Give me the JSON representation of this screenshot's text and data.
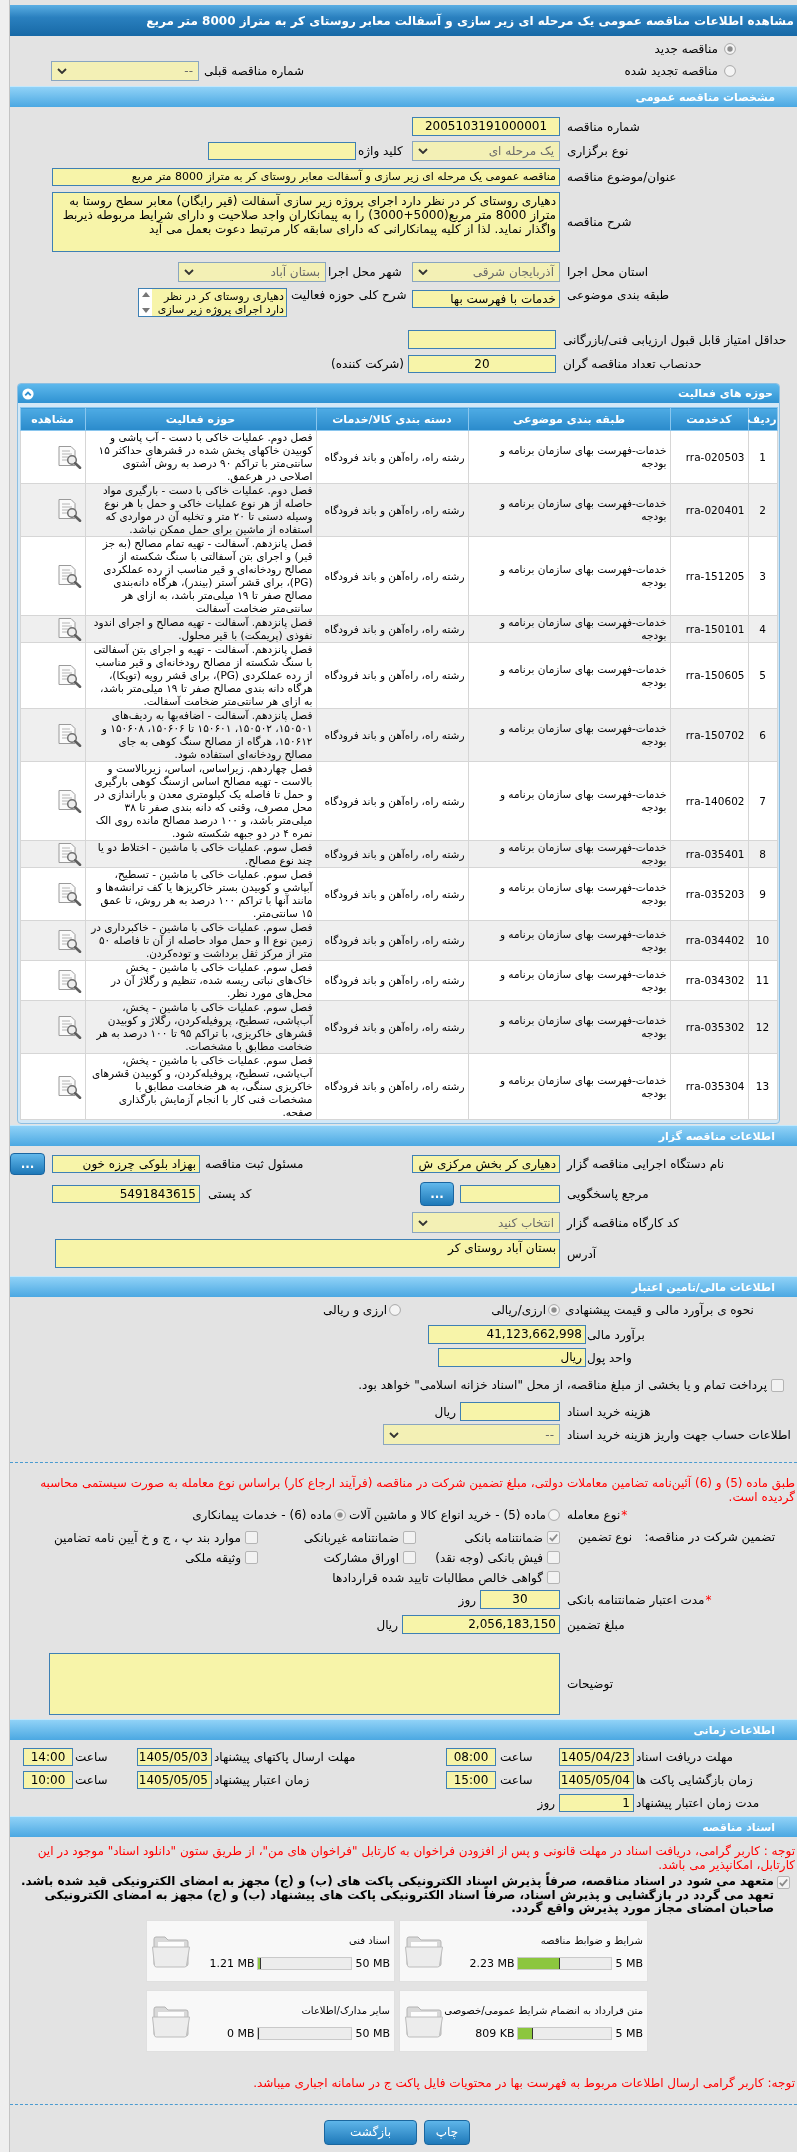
{
  "window": {
    "title": "مشاهده اطلاعات مناقصه عمومی یک مرحله ای زیر سازی و آسفالت معابر روستای کر به متراز 8000 متر مربع"
  },
  "tender_kind": {
    "options": [
      {
        "label": "مناقصه جدید",
        "selected": true
      },
      {
        "label": "مناقصه تجدید شده",
        "selected": false
      }
    ],
    "previous_number": {
      "label": "شماره مناقصه قبلی",
      "value": "--"
    }
  },
  "general": {
    "title": "مشخصات مناقصه عمومی",
    "tender_number": {
      "label": "شماره مناقصه",
      "value": "2005103191000001"
    },
    "holding_type": {
      "label": "نوع برگزاری",
      "value": "یک مرحله ای"
    },
    "keyword": {
      "label": "کلید واژه"
    },
    "subject": {
      "label": "عنوان/موضوع مناقصه",
      "value": "مناقصه عمومی یک مرحله ای زیر سازی و آسفالت معابر روستای کر به متراز 8000 متر مربع"
    },
    "description": {
      "label": "شرح مناقصه",
      "value": "دهیاری روستای کر در نظر دارد  اجرای پروژه زیر سازی آسفالت (قیر رایگان) معابر سطح روستا به متراز 8000 متر مربع(5000+3000) را به پیمانکاران واجد صلاحیت و دارای شرایط مربوطه  ذیربط واگذار نماید. لذا از کلیه پیمانکارانی که دارای سابقه کار مرتبط  دعوت بعمل می آید"
    },
    "province": {
      "label": "استان محل اجرا",
      "value": "آذربایجان شرقی"
    },
    "city": {
      "label": "شهر محل اجرا",
      "value": "بستان آباد"
    },
    "classification": {
      "label": "طبقه بندی موضوعی",
      "value": "خدمات با فهرست بها"
    },
    "activity_summary": {
      "label": "شرح کلی حوزه فعالیت",
      "value": "دهیاری روستای کر در نظر دارد  اجرای پروژه زیر سازی"
    },
    "min_score": {
      "label": "حداقل امتیاز قابل قبول ارزیابی فنی/بازرگانی"
    },
    "min_bidders": {
      "label": "حدنصاب تعداد مناقصه گران",
      "value": "20",
      "unit": "(شرکت کننده)"
    }
  },
  "activities": {
    "title": "حوزه های فعالیت",
    "columns": [
      "ردیف",
      "کدخدمت",
      "طبقه بندی موضوعی",
      "دسته بندی کالا/خدمات",
      "حوزه فعالیت",
      "مشاهده"
    ],
    "rows": [
      {
        "index": "1",
        "code": "rra-020503",
        "classification": "خدمات-فهرست بهای سازمان برنامه و بودجه",
        "category": "رشته راه، راه‌آهن و باند فرودگاه",
        "activity": "فصل دوم. عملیات خاکی با دست - آب پاشی و کوبیدن خاکهای پخش شده در قشرهای حداکثر ۱۵ سانتی‌متر با تراکم ۹۰ درصد به روش آشتوی اصلاحی در هرعمق."
      },
      {
        "index": "2",
        "code": "rra-020401",
        "classification": "خدمات-فهرست بهای سازمان برنامه و بودجه",
        "category": "رشته راه، راه‌آهن و باند فرودگاه",
        "activity": "فصل دوم. عملیات خاکی با دست - بارگیری مواد حاصله از هر نوع عملیات خاکی و حمل با هر نوع وسیله دستی تا ۲۰ متر و تخلیه آن در مواردی که استفاده از ماشین برای حمل ممکن نباشد."
      },
      {
        "index": "3",
        "code": "rra-151205",
        "classification": "خدمات-فهرست بهای سازمان برنامه و بودجه",
        "category": "رشته راه، راه‌آهن و باند فرودگاه",
        "activity": "فصل پانزدهم. آسفالت - تهیه تمام مصالح (به جز قیر) و اجرای بتن آسفالتی با سنگ شکسته از مصالح رودخانه‌ای و قیر مناسب از رده عملکردی (PG)، برای قشر آستر (بیندر)، هرگاه دانه‌بندی مصالح صفر تا ۱۹ میلی‌متر باشد، به ازای هر سانتی‌متر ضخامت آسفالت"
      },
      {
        "index": "4",
        "code": "rra-150101",
        "classification": "خدمات-فهرست بهای سازمان برنامه و بودجه",
        "category": "رشته راه، راه‌آهن و باند فرودگاه",
        "activity": "فصل پانزدهم. آسفالت - تهیه مصالح و اجرای اندود نفوذی (پریمکت) با قیر محلول."
      },
      {
        "index": "5",
        "code": "rra-150605",
        "classification": "خدمات-فهرست بهای سازمان برنامه و بودجه",
        "category": "رشته راه، راه‌آهن و باند فرودگاه",
        "activity": "فصل پانزدهم. آسفالت - تهیه و اجرای بتن آسفالتی با سنگ شکسته از مصالح رودخانه‌ای و قیر مناسب از رده عملکردی (PG)، برای قشر رویه (توپکا)، هرگاه دانه بندی مصالح صفر تا ۱۹ میلی‌متر باشد، به ازای هر سانتی‌متر ضخامت آسفالت."
      },
      {
        "index": "6",
        "code": "rra-150702",
        "classification": "خدمات-فهرست بهای سازمان برنامه و بودجه",
        "category": "رشته راه، راه‌آهن و باند فرودگاه",
        "activity": "فصل پانزدهم. آسفالت - اضافه‌بها به ردیف‌های ۱۵۰۵۰۱، ۱۵۰۵۰۲، ۱۵۰۶۰۱ تا ۱۵۰۶۰۶، ۱۵۰۶۰۸ و ۱۵۰۶۱۲، هرگاه از مصالح سنگ کوهی به جای مصالح رودخانه‌ای استفاده شود."
      },
      {
        "index": "7",
        "code": "rra-140602",
        "classification": "خدمات-فهرست بهای سازمان برنامه و بودجه",
        "category": "رشته راه، راه‌آهن و باند فرودگاه",
        "activity": "فصل چهاردهم. زیراساس، اساس، زیربالاست و بالاست - تهیه مصالح اساس ازسنگ کوهی بارگیری و حمل تا فاصله یک کیلومتری معدن و باراندازی در محل مصرف، وقتی که دانه بندی صفر تا ۳۸ میلی‌متر باشد، و ۱۰۰ درصد مصالح مانده روی الک نمره ۴ در دو جبهه شکسته شود."
      },
      {
        "index": "8",
        "code": "rra-035401",
        "classification": "خدمات-فهرست بهای سازمان برنامه و بودجه",
        "category": "رشته راه، راه‌آهن و باند فرودگاه",
        "activity": "فصل سوم. عملیات خاکی با ماشین - اختلاط دو یا چند نوع مصالح."
      },
      {
        "index": "9",
        "code": "rra-035203",
        "classification": "خدمات-فهرست بهای سازمان برنامه و بودجه",
        "category": "رشته راه، راه‌آهن و باند فرودگاه",
        "activity": "فصل سوم. عملیات خاکی با ماشین - تسطیح، آبپاشي و کوبيدن بستر خاکریزها یا کف ترانشه‌ها و مانند آنها با تراکم ۱۰۰ درصد به هر روش، تا عمق ۱۵ سانتی‌متر."
      },
      {
        "index": "10",
        "code": "rra-034402",
        "classification": "خدمات-فهرست بهای سازمان برنامه و بودجه",
        "category": "رشته راه، راه‌آهن و باند فرودگاه",
        "activity": "فصل سوم. عملیات خاکی با ماشین - خاکبرداری در زمین نوع II و حمل مواد حاصله از آن تا فاصله ۵۰ متر از مرکز ثقل برداشت و توده‌کردن."
      },
      {
        "index": "11",
        "code": "rra-034302",
        "classification": "خدمات-فهرست بهای سازمان برنامه و بودجه",
        "category": "رشته راه، راه‌آهن و باند فرودگاه",
        "activity": "فصل سوم. عملیات خاکی با ماشین - پخش خاک‌های نباتی ریسه شده، تنظیم و رگلاژ آن در محل‌های مورد نظر."
      },
      {
        "index": "12",
        "code": "rra-035302",
        "classification": "خدمات-فهرست بهای سازمان برنامه و بودجه",
        "category": "رشته راه، راه‌آهن و باند فرودگاه",
        "activity": "فصل سوم. عملیات خاکی با ماشین - پخش، آب‌پاشی، تسطیح، پروفیله‌کردن، رگلاژ و کوبیدن قشرهای خاکریزی، با تراکم ۹۵ تا ۱۰۰ درصد به هر ضخامت مطابق با مشخصات."
      },
      {
        "index": "13",
        "code": "rra-035304",
        "classification": "خدمات-فهرست بهای سازمان برنامه و بودجه",
        "category": "رشته راه، راه‌آهن و باند فرودگاه",
        "activity": "فصل سوم. عملیات خاکی با ماشین - پخش، آب‌پاشی، تسطیح، پروفیله‌کردن، و کوبیدن قشرهای خاکریزی سنگی، به هر ضخامت مطابق با مشخصات فنی کار با انجام آزمایش بارگذاری صفحه."
      }
    ]
  },
  "tenderer": {
    "title": "اطلاعات مناقصه گزار",
    "agency": {
      "label": "نام دستگاه اجرایی مناقصه گزار",
      "value": "دهیاری کر بخش مرکزی ش"
    },
    "registrar": {
      "label": "مسئول ثبت مناقصه",
      "value": "بهزاد بلوکی چرزه خون",
      "button": "..."
    },
    "reference": {
      "label": "مرجع پاسخگویی",
      "button": "..."
    },
    "postal_code": {
      "label": "کد پستی",
      "value": "5491843615"
    },
    "workshop_code": {
      "label": "کد کارگاه مناقصه گزار",
      "value": "انتخاب کنید"
    },
    "address": {
      "label": "آدرس",
      "value": "بستان آباد روستای کر"
    }
  },
  "finance": {
    "title": "اطلاعات مالی/تامین اعتبار",
    "estimate_method": {
      "label": "نحوه ی برآورد مالی و قیمت پیشنهادی",
      "options": [
        {
          "label": "ارزی/ریالی",
          "selected": true
        },
        {
          "label": "ارزی و ریالی",
          "selected": false
        }
      ]
    },
    "estimate": {
      "label": "برآورد مالی",
      "value": "41,123,662,998"
    },
    "currency": {
      "label": "واحد پول",
      "value": "ریال"
    },
    "treasury": {
      "label": "پرداخت تمام و یا بخشی از مبلغ مناقصه، از محل \"اسناد خزانه اسلامی\" خواهد بود.",
      "checked": false
    },
    "document_fee": {
      "label": "هزینه خرید اسناد",
      "unit": "ریال"
    },
    "account": {
      "label": "اطلاعات حساب جهت واریز هزینه خرید اسناد",
      "value": "--"
    }
  },
  "guarantee": {
    "notice": "طبق ماده (5) و (6) آئین‌نامه تضامین معاملات دولتی، مبلغ تضمین شرکت در مناقصه (فرآیند ارجاع کار) براساس نوع معامله به صورت سیستمی محاسبه گردیده است.",
    "deal_type": {
      "required_mark": "*",
      "label": "نوع معامله",
      "options": [
        {
          "label": "ماده (5) - خرید انواع کالا و ماشین آلات",
          "selected": false
        },
        {
          "label": "ماده (6) - خدمات پیمانکاری",
          "selected": true
        }
      ]
    },
    "label": "تضمین شرکت در مناقصه:",
    "type_label": "نوع تضمین",
    "types": [
      {
        "label": "ضمانتنامه بانکی",
        "checked": true
      },
      {
        "label": "ضمانتنامه غیربانکی",
        "checked": false
      },
      {
        "label": "موارد بند پ ، ج و خ آیین نامه تضامین",
        "checked": false
      },
      {
        "label": "فیش بانکی (وجه نقد)",
        "checked": false
      },
      {
        "label": "اوراق مشارکت",
        "checked": false
      },
      {
        "label": "وثیقه ملکی",
        "checked": false
      },
      {
        "label": "گواهی خالص مطالبات تایید شده قراردادها",
        "checked": false
      }
    ],
    "validity": {
      "required_mark": "*",
      "label": "مدت اعتبار ضمانتنامه بانکی",
      "value": "30",
      "unit": "روز"
    },
    "amount": {
      "label": "مبلغ تضمین",
      "value": "2,056,183,150",
      "unit": "ریال"
    },
    "notes": {
      "label": "توضیحات"
    }
  },
  "schedule": {
    "title": "اطلاعات زمانی",
    "items": [
      {
        "label": "مهلت دریافت اسناد",
        "date": "1405/04/23",
        "time_label": "ساعت",
        "time": "08:00"
      },
      {
        "label": "مهلت ارسال پاکتهای پیشنهاد",
        "date": "1405/05/03",
        "time_label": "ساعت",
        "time": "14:00"
      },
      {
        "label": "زمان بازگشایی پاکت ها",
        "date": "1405/05/04",
        "time_label": "ساعت",
        "time": "15:00"
      },
      {
        "label": "زمان اعتبار پیشنهاد",
        "date": "1405/05/05",
        "time_label": "ساعت",
        "time": "10:00"
      }
    ],
    "validity": {
      "label": "مدت زمان اعتبار پیشنهاد",
      "value": "1",
      "unit": "روز"
    }
  },
  "documents": {
    "title": "اسناد مناقصه",
    "notice": "توجه : کاربر گرامی، دریافت اسناد در مهلت قانونی و پس از افزودن فراخوان به کارتابل \"فراخوان های من\"، از طریق ستون \"دانلود اسناد\" موجود در این کارتابل، امکانپذیر می باشد.",
    "commitment": {
      "text": "متعهد می شود در اسناد مناقصه، صرفاً پذیرش اسناد الکترونیکی پاکت های (ب) و (ج) مجهز به امضای الکترونیکی قید شده باشد. تعهد می گردد در بازگشایی و پذیرش اسناد، صرفاً اسناد الکترونیکی پاکت های پیشنهاد (ب) و (ج) مجهز به امضای الکترونیکی صاحبان امضای مجاز مورد پذیرش واقع گردد.",
      "checked": true
    },
    "files": [
      {
        "title": "شرایط و ضوابط مناقصه",
        "max": "5 MB",
        "size": "2.23 MB",
        "level": 0.45
      },
      {
        "title": "اسناد فنی",
        "max": "50 MB",
        "size": "1.21 MB",
        "level": 0.03
      },
      {
        "title": "متن قرارداد به انضمام شرایط عمومی/خصوصی",
        "max": "5 MB",
        "size": "809 KB",
        "level": 0.16
      },
      {
        "title": "سایر مدارک/اطلاعات",
        "max": "50 MB",
        "size": "0 MB",
        "level": 0
      }
    ],
    "footer_notice": "توجه: کاربر گرامی ارسال اطلاعات مربوط به فهرست بها در محتویات فایل پاکت ج در سامانه اجباری میباشد."
  },
  "buttons": [
    "چاپ",
    "بازگشت"
  ]
}
